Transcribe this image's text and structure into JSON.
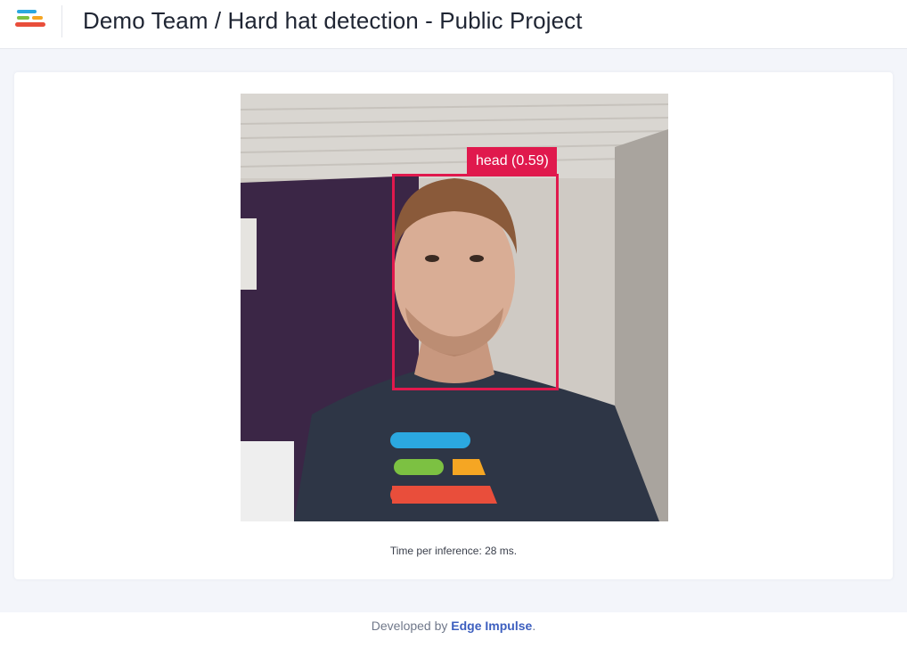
{
  "header": {
    "title": "Demo Team / Hard hat detection - Public Project",
    "logo_icon": "edge-impulse-logo-icon"
  },
  "camera": {
    "detections": [
      {
        "label": "head (0.59)",
        "class": "head",
        "confidence": 0.59
      }
    ],
    "bbox_color": "#e0194d"
  },
  "stats": {
    "inference_text": "Time per inference: 28 ms."
  },
  "footer": {
    "prefix": "Developed by ",
    "link_text": "Edge Impulse",
    "suffix": "."
  },
  "colors": {
    "accent": "#3d5fbf",
    "detection": "#e0194d",
    "background": "#f3f5fa"
  }
}
